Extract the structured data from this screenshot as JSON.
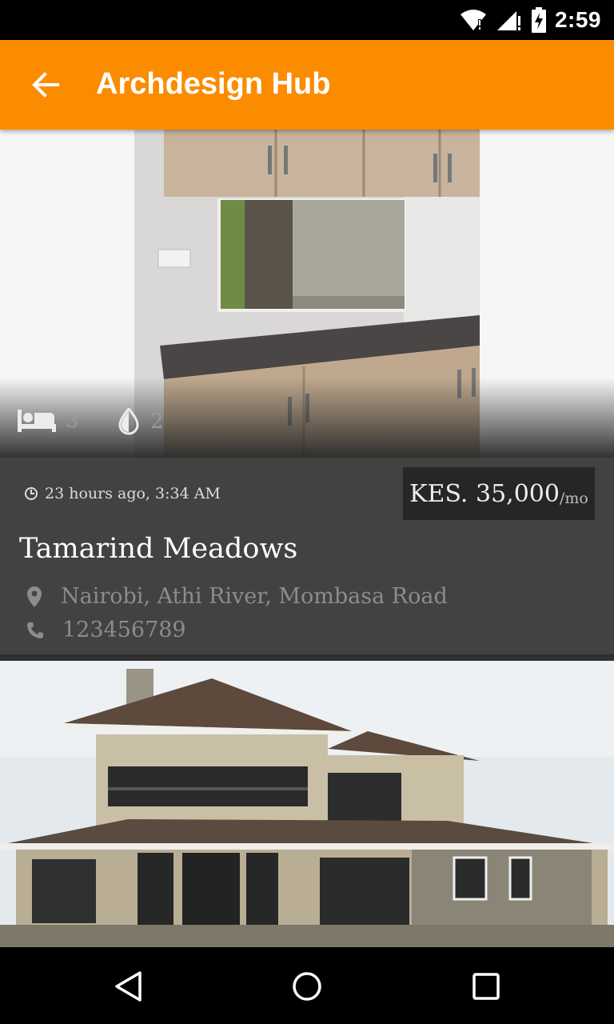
{
  "status_bar": {
    "time": "2:59",
    "icons": [
      "wifi-alert-icon",
      "signal-alert-icon",
      "battery-charging-icon"
    ]
  },
  "app_bar": {
    "title": "Archdesign Hub",
    "back_icon": "arrow-back-icon",
    "color": "#fb8c00"
  },
  "listings": [
    {
      "bedrooms": "3",
      "bathrooms": "2",
      "posted": "23 hours ago, 3:34 AM",
      "price": "KES. 35,000",
      "price_unit": "/mo",
      "title": "Tamarind Meadows",
      "location": "Nairobi, Athi River, Mombasa Road",
      "phone": "123456789"
    }
  ],
  "nav_bar": {
    "buttons": [
      "back-triangle-icon",
      "home-circle-icon",
      "recents-square-icon"
    ]
  }
}
